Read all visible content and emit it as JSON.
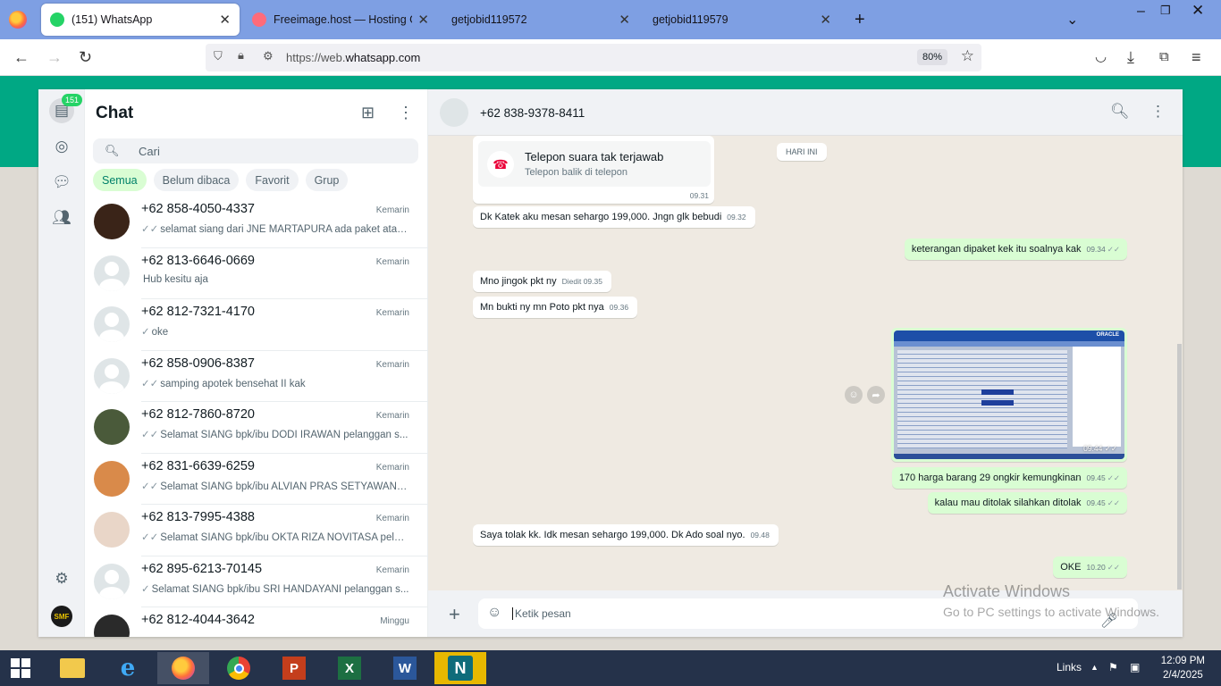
{
  "browser": {
    "tabs": [
      {
        "title": "(151) WhatsApp",
        "active": true
      },
      {
        "title": "Freeimage.host — Hosting Gam"
      },
      {
        "title": "getjobid119572"
      },
      {
        "title": "getjobid119579"
      }
    ],
    "url_prefix": "https://web.",
    "url_domain": "whatsapp.com",
    "zoom": "80%"
  },
  "rail": {
    "unread_badge": "151",
    "avatar_text": "SMF"
  },
  "sidebar": {
    "title": "Chat",
    "search_placeholder": "Cari",
    "filters": [
      "Semua",
      "Belum dibaca",
      "Favorit",
      "Grup"
    ],
    "chats": [
      {
        "name": "+62 858-4050-4337",
        "time": "Kemarin",
        "tick": "✓✓",
        "preview": "selamat siang dari JNE MARTAPURA ada paket atas n...",
        "avatar_color": "#3a2418"
      },
      {
        "name": "+62 813-6646-0669",
        "time": "Kemarin",
        "tick": "",
        "preview": "Hub kesitu aja",
        "avatar_color": ""
      },
      {
        "name": "+62 812-7321-4170",
        "time": "Kemarin",
        "tick": "✓",
        "preview": "oke",
        "avatar_color": ""
      },
      {
        "name": "+62 858-0906-8387",
        "time": "Kemarin",
        "tick": "✓✓",
        "preview": "samping apotek bensehat II kak",
        "avatar_color": ""
      },
      {
        "name": "+62 812-7860-8720",
        "time": "Kemarin",
        "tick": "✓✓",
        "preview": "Selamat SIANG  bpk/ibu DODI IRAWAN pelanggan s...",
        "avatar_color": "#4a5a3a"
      },
      {
        "name": "+62 831-6639-6259",
        "time": "Kemarin",
        "tick": "✓✓",
        "preview": "Selamat SIANG  bpk/ibu ALVIAN PRAS SETYAWAN pel...",
        "avatar_color": "#d98a4a"
      },
      {
        "name": "+62 813-7995-4388",
        "time": "Kemarin",
        "tick": "✓✓",
        "preview": "Selamat SIANG  bpk/ibu OKTA RIZA  NOVITASA pelan...",
        "avatar_color": "#e9d6c8"
      },
      {
        "name": "+62 895-6213-70145",
        "time": "Kemarin",
        "tick": "✓",
        "preview": "Selamat SIANG  bpk/ibu SRI HANDAYANI pelanggan s...",
        "avatar_color": ""
      },
      {
        "name": "+62 812-4044-3642",
        "time": "Minggu",
        "tick": "",
        "preview": "",
        "avatar_color": "#2a2a2a"
      }
    ]
  },
  "conversation": {
    "contact": "+62 838-9378-8411",
    "call_title": "Telepon suara tak terjawab",
    "call_subtitle": "Telepon balik di telepon",
    "call_time": "09.31",
    "day_label": "HARI INI",
    "messages": [
      {
        "text": "Dk Katek aku mesan sehargo 199,000. Jngn glk bebudi",
        "meta": "09.32",
        "tick": ""
      },
      {
        "text": "keterangan dipaket kek itu soalnya kak",
        "meta": "09.34",
        "tick": "✓✓"
      },
      {
        "text": "Mno jingok pkt ny",
        "meta": "Diedit 09.35",
        "tick": ""
      },
      {
        "text": "Mn bukti ny mn Poto pkt nya",
        "meta": "09.36",
        "tick": ""
      },
      {
        "text": "170 harga barang 29 ongkir kemungkinan",
        "meta": "09.45",
        "tick": "✓✓"
      },
      {
        "text": "kalau mau ditolak silahkan ditolak",
        "meta": "09.45",
        "tick": "✓✓"
      },
      {
        "text": "Saya tolak kk. Idk mesan sehargo 199,000. Dk Ado soal nyo.",
        "meta": "09.48",
        "tick": ""
      },
      {
        "text": "OKE",
        "meta": "10.20",
        "tick": "✓✓"
      }
    ],
    "image_time": "09.44",
    "image_tick": "✓✓",
    "image_brand": "ORACLE",
    "composer_placeholder": "Ketik pesan"
  },
  "watermark": {
    "line1": "Activate Windows",
    "line2": "Go to PC settings to activate Windows."
  },
  "taskbar": {
    "apps": [
      "N"
    ],
    "tray_links": "Links",
    "time": "12:09 PM",
    "date": "2/4/2025"
  }
}
